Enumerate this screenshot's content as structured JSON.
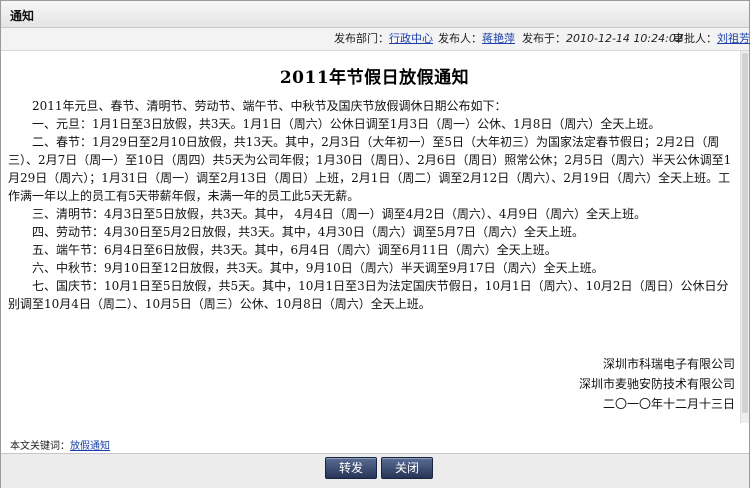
{
  "window": {
    "title": "通知"
  },
  "info": {
    "dept_label": "发布部门：",
    "dept_value": "行政中心",
    "publisher_label": "发布人：",
    "publisher_value": "蒋艳萍",
    "date_label": "发布于：",
    "date_value": "2010-12-14 10:24:02",
    "approver_label": "审批人：",
    "approver_value": "刘祖芳"
  },
  "doc": {
    "title": "2011年节假日放假通知",
    "paragraphs": [
      "2011年元旦、春节、清明节、劳动节、端午节、中秋节及国庆节放假调休日期公布如下：",
      "一、元旦：1月1日至3日放假，共3天。1月1日（周六）公休日调至1月3日（周一）公休、1月8日（周六）全天上班。",
      "二、春节：1月29日至2月10日放假，共13天。其中，2月3日（大年初一）至5日（大年初三）为国家法定春节假日；2月2日（周三）、2月7日（周一）至10日（周四）共5天为公司年假；1月30日（周日）、2月6日（周日）照常公休；2月5日（周六）半天公休调至1月29日（周六）；1月31日（周一）调至2月13日（周日）上班，2月1日（周二）调至2月12日（周六）、2月19日（周六）全天上班。工作满一年以上的员工有5天带薪年假，未满一年的员工此5天无薪。",
      "三、清明节：4月3日至5日放假，共3天。其中， 4月4日（周一）调至4月2日（周六）、4月9日（周六）全天上班。",
      "四、劳动节：4月30日至5月2日放假，共3天。其中，4月30日（周六）调至5月7日（周六）全天上班。",
      "五、端午节：6月4日至6日放假，共3天。其中，6月4日（周六）调至6月11日（周六）全天上班。",
      "六、中秋节：9月10日至12日放假，共3天。其中，9月10日（周六）半天调至9月17日（周六）全天上班。",
      "七、国庆节：10月1日至5日放假，共5天。其中，10月1日至3日为法定国庆节假日，10月1日（周六）、10月2日（周日）公休日分别调至10月4日（周二）、10月5日（周三）公休、10月8日（周六）全天上班。"
    ],
    "signature": {
      "company1": "深圳市科瑞电子有限公司",
      "company2": "深圳市麦驰安防技术有限公司",
      "date": "二〇一〇年十二月十三日"
    }
  },
  "keywords": {
    "label": "本文关键词：",
    "value": "放假通知"
  },
  "buttons": {
    "forward": "转发",
    "close": "关闭"
  }
}
